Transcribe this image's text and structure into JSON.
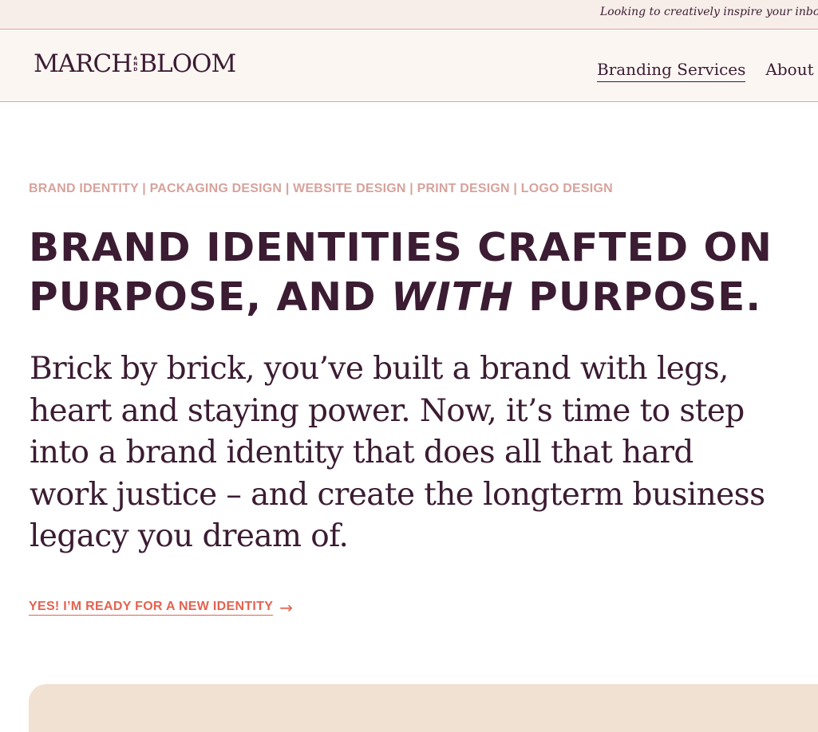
{
  "announcement": {
    "text": "Looking to creatively inspire your inbox? S"
  },
  "header": {
    "logo": {
      "left": "MARCH",
      "and_letters": [
        "A",
        "N",
        "D"
      ],
      "right": "BLOOM"
    },
    "nav": [
      {
        "label": "Branding Services",
        "active": true
      },
      {
        "label": "About",
        "active": false
      }
    ]
  },
  "main": {
    "services_line": "BRAND IDENTITY | PACKAGING DESIGN | WEBSITE DESIGN | PRINT DESIGN | LOGO DESIGN",
    "headline": {
      "line1": "BRAND IDENTITIES CRAFTED ON",
      "line2_start": "PURPOSE, AND ",
      "line2_em": "WITH",
      "line2_end": " PURPOSE."
    },
    "lede": "Brick by brick, you’ve built a brand with legs, heart and staying power. Now, it’s time to step into a brand identity that does all that hard work justice – and create the longterm business legacy you dream of.",
    "cta": {
      "label": "YES! I’M READY FOR A NEW IDENTITY",
      "arrow": "→"
    }
  },
  "colors": {
    "plum": "#3b1c32",
    "blush": "#d7a29c",
    "coral": "#e3624f",
    "announcement_bg": "#f7eeea",
    "header_bg": "#fcf6f3",
    "panel_bg": "#f0e1d2"
  }
}
